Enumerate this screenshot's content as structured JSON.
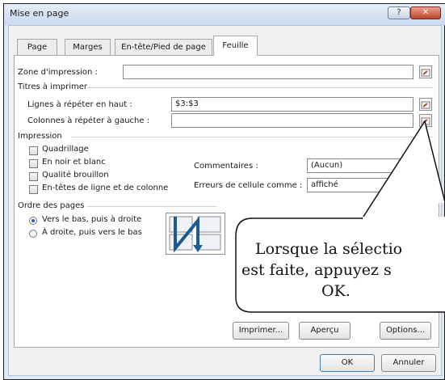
{
  "window": {
    "title": "Mise en page",
    "help_label": "?",
    "close_label": "✕"
  },
  "tabs": [
    {
      "label": "Page"
    },
    {
      "label": "Marges"
    },
    {
      "label": "En-tête/Pied de page"
    },
    {
      "label": "Feuille"
    }
  ],
  "zone": {
    "label": "Zone d'impression :",
    "value": ""
  },
  "titres": {
    "section": "Titres à imprimer",
    "rows_label": "Lignes à répéter en haut :",
    "rows_value": "$3:$3",
    "cols_label": "Colonnes à répéter à gauche :",
    "cols_value": ""
  },
  "impression": {
    "section": "Impression",
    "checks": [
      "Quadrillage",
      "En noir et blanc",
      "Qualité brouillon",
      "En-têtes de ligne et de colonne"
    ],
    "comments_label": "Commentaires :",
    "comments_value": "(Aucun)",
    "errors_label": "Erreurs de cellule comme :",
    "errors_value": "affiché"
  },
  "ordre": {
    "section": "Ordre des pages",
    "opt1": "Vers le bas, puis à droite",
    "opt2": "À droite, puis vers le bas"
  },
  "buttons": {
    "print": "Imprimer...",
    "preview": "Aperçu",
    "options": "Options...",
    "ok": "OK",
    "cancel": "Annuler"
  },
  "callout": {
    "line1": "Lorsque la sélectio",
    "line2": "est faite, appuyez s",
    "line3": "OK."
  }
}
